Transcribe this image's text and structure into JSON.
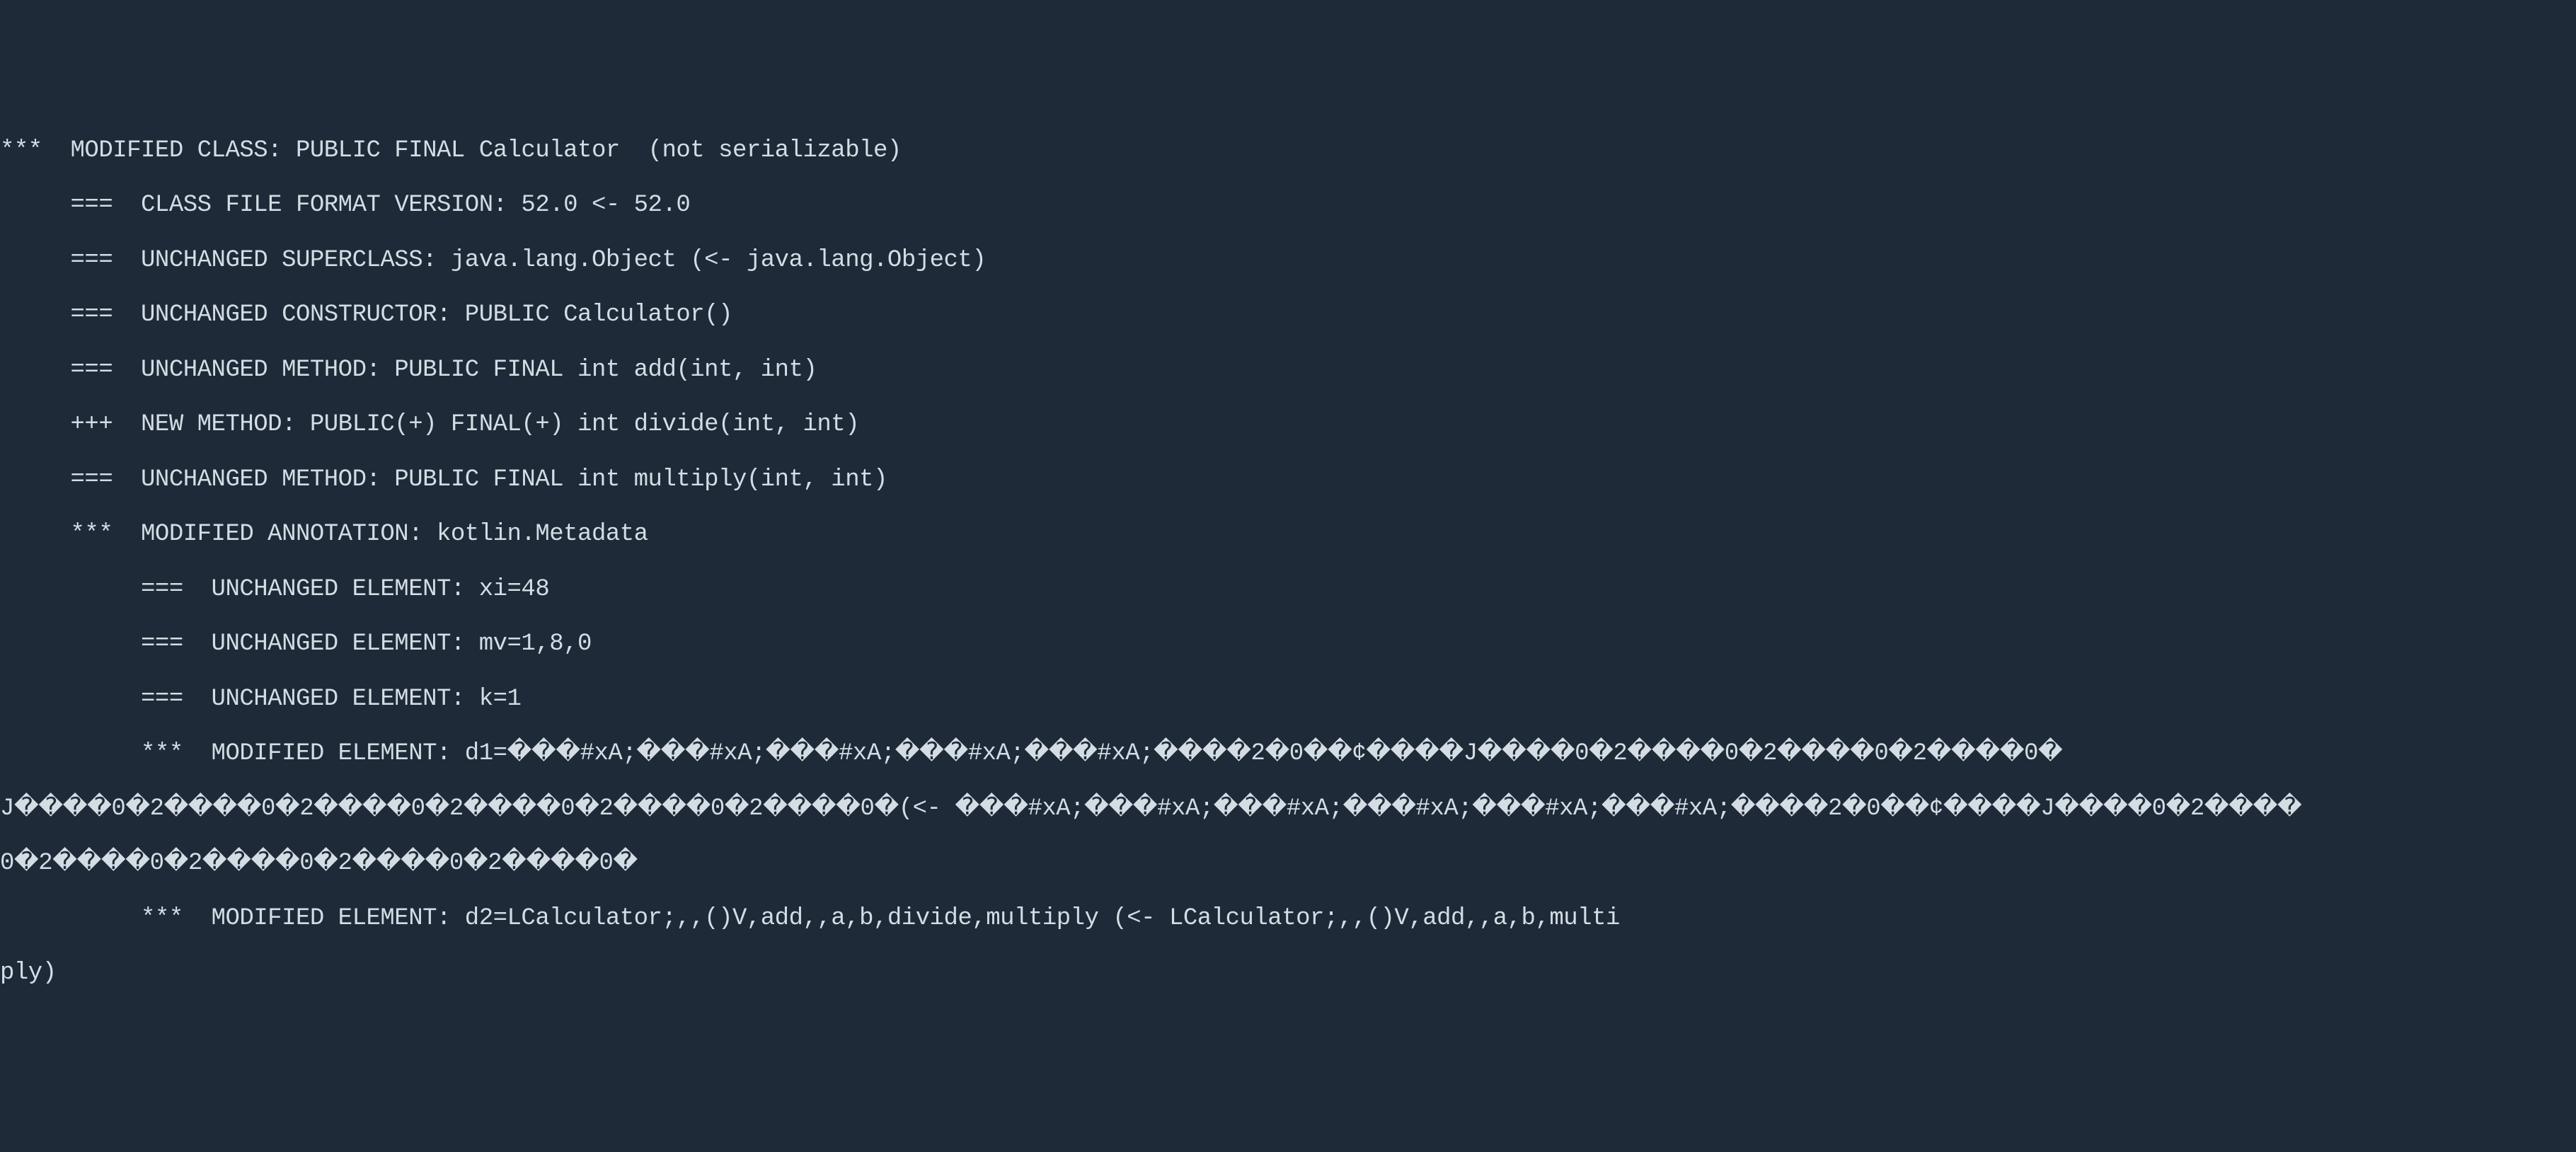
{
  "lines": [
    "***  MODIFIED CLASS: PUBLIC FINAL Calculator  (not serializable)",
    "     ===  CLASS FILE FORMAT VERSION: 52.0 <- 52.0",
    "     ===  UNCHANGED SUPERCLASS: java.lang.Object (<- java.lang.Object)",
    "     ===  UNCHANGED CONSTRUCTOR: PUBLIC Calculator()",
    "     ===  UNCHANGED METHOD: PUBLIC FINAL int add(int, int)",
    "     +++  NEW METHOD: PUBLIC(+) FINAL(+) int divide(int, int)",
    "     ===  UNCHANGED METHOD: PUBLIC FINAL int multiply(int, int)",
    "     ***  MODIFIED ANNOTATION: kotlin.Metadata",
    "          ===  UNCHANGED ELEMENT: xi=48",
    "          ===  UNCHANGED ELEMENT: mv=1,8,0",
    "          ===  UNCHANGED ELEMENT: k=1",
    "          ***  MODIFIED ELEMENT: d1=���#xA;���#xA;���#xA;���#xA;���#xA;����2�0��¢����J����0�2����0�2����0�2����0�",
    "J����0�2����0�2����0�2����0�2����0�2����0�(<- ���#xA;���#xA;���#xA;���#xA;���#xA;���#xA;����2�0��¢����J����0�2����",
    "0�2����0�2����0�2����0�2����0�",
    "          ***  MODIFIED ELEMENT: d2=LCalculator;,,()V,add,,a,b,divide,multiply (<- LCalculator;,,()V,add,,a,b,multi",
    "ply)"
  ]
}
